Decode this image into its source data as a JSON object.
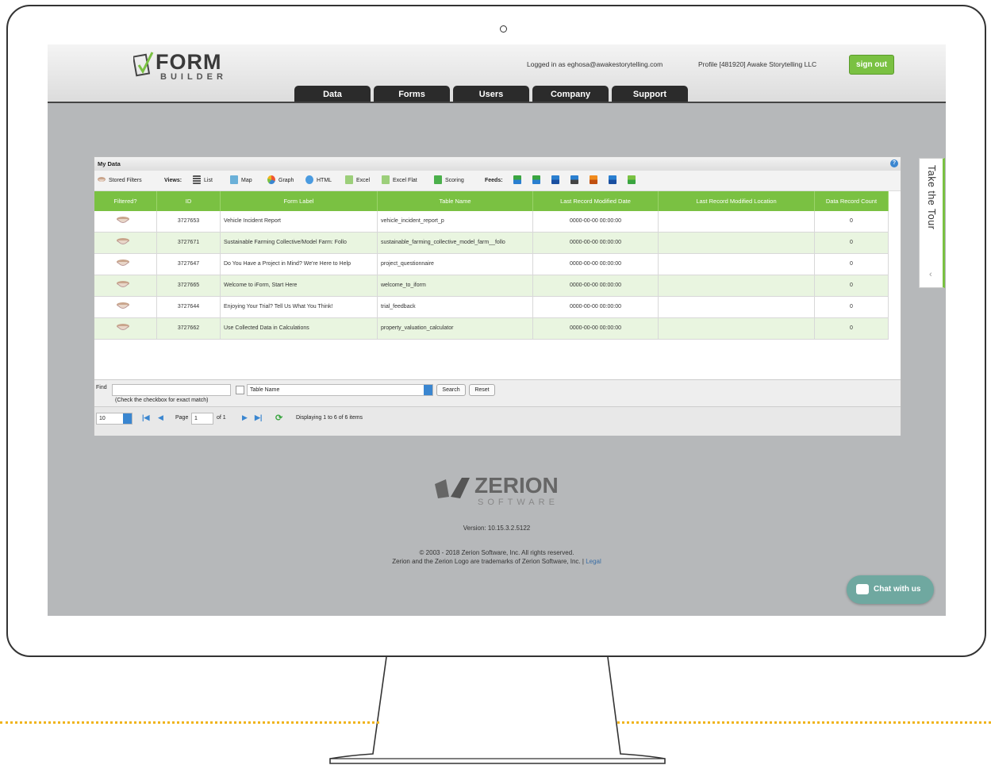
{
  "header": {
    "logo_form": "FORM",
    "logo_builder": "BUILDER",
    "logged_in": "Logged in as eghosa@awakestorytelling.com",
    "profile": "Profile [481920] Awake Storytelling LLC",
    "sign_out": "sign out"
  },
  "nav_tabs": [
    "Data",
    "Forms",
    "Users",
    "Company",
    "Support"
  ],
  "tour": {
    "label": "Take the Tour",
    "chevron": "‹"
  },
  "panel": {
    "title": "My Data",
    "help": "?",
    "toolbar": {
      "stored_filters": "Stored Filters",
      "views_label": "Views:",
      "views": [
        "List",
        "Map",
        "Graph",
        "HTML",
        "Excel",
        "Excel Flat",
        "Scoring"
      ],
      "feeds_label": "Feeds:",
      "feed_icons": [
        "xls-feed-icon",
        "xlsx-feed-icon",
        "kml-feed-icon",
        "json-feed-icon",
        "rss-feed-icon",
        "pdf-feed-icon",
        "json2-feed-icon"
      ]
    },
    "columns": [
      "Filtered?",
      "ID",
      "Form Label",
      "Table Name",
      "Last Record Modified Date",
      "Last Record Modified Location",
      "Data Record Count"
    ],
    "rows": [
      {
        "id": "3727653",
        "label": "Vehicle Incident Report",
        "table": "vehicle_incident_report_p",
        "date": "0000-00-00 00:00:00",
        "location": "",
        "count": "0"
      },
      {
        "id": "3727671",
        "label": "Sustainable Farming Collective/Model Farm: Follo",
        "table": "sustainable_farming_collective_model_farm__follo",
        "date": "0000-00-00 00:00:00",
        "location": "",
        "count": "0"
      },
      {
        "id": "3727647",
        "label": "Do You Have a Project in Mind? We're Here to Help",
        "table": "project_questionnaire",
        "date": "0000-00-00 00:00:00",
        "location": "",
        "count": "0"
      },
      {
        "id": "3727665",
        "label": "Welcome to iForm, Start Here",
        "table": "welcome_to_iform",
        "date": "0000-00-00 00:00:00",
        "location": "",
        "count": "0"
      },
      {
        "id": "3727644",
        "label": "Enjoying Your Trial? Tell Us What You Think!",
        "table": "trial_feedback",
        "date": "0000-00-00 00:00:00",
        "location": "",
        "count": "0"
      },
      {
        "id": "3727662",
        "label": "Use Collected Data in Calculations",
        "table": "property_valuation_calculator",
        "date": "0000-00-00 00:00:00",
        "location": "",
        "count": "0"
      }
    ],
    "find": {
      "label": "Find",
      "value": "",
      "exact_hint": "(Check the checkbox for exact match)",
      "field_select": "Table Name",
      "search": "Search",
      "reset": "Reset"
    },
    "pager": {
      "page_size": "10",
      "page_label": "Page",
      "page_value": "1",
      "of": "of 1",
      "displaying": "Displaying 1 to 6 of 6 items"
    }
  },
  "footer": {
    "brand": "ZERION",
    "brand_sub": "SOFTWARE",
    "version": "Version: 10.15.3.2.5122",
    "copyright": "© 2003 - 2018 Zerion Software, Inc. All rights reserved.",
    "trademark": "Zerion and the Zerion Logo are trademarks of Zerion Software, Inc. |",
    "legal": "Legal"
  },
  "chat": {
    "label": "Chat with us"
  },
  "colors": {
    "accent": "#7ac142",
    "nav": "#2b2b2b",
    "chat": "#6fa8a0",
    "dots": "#f0b41c"
  }
}
